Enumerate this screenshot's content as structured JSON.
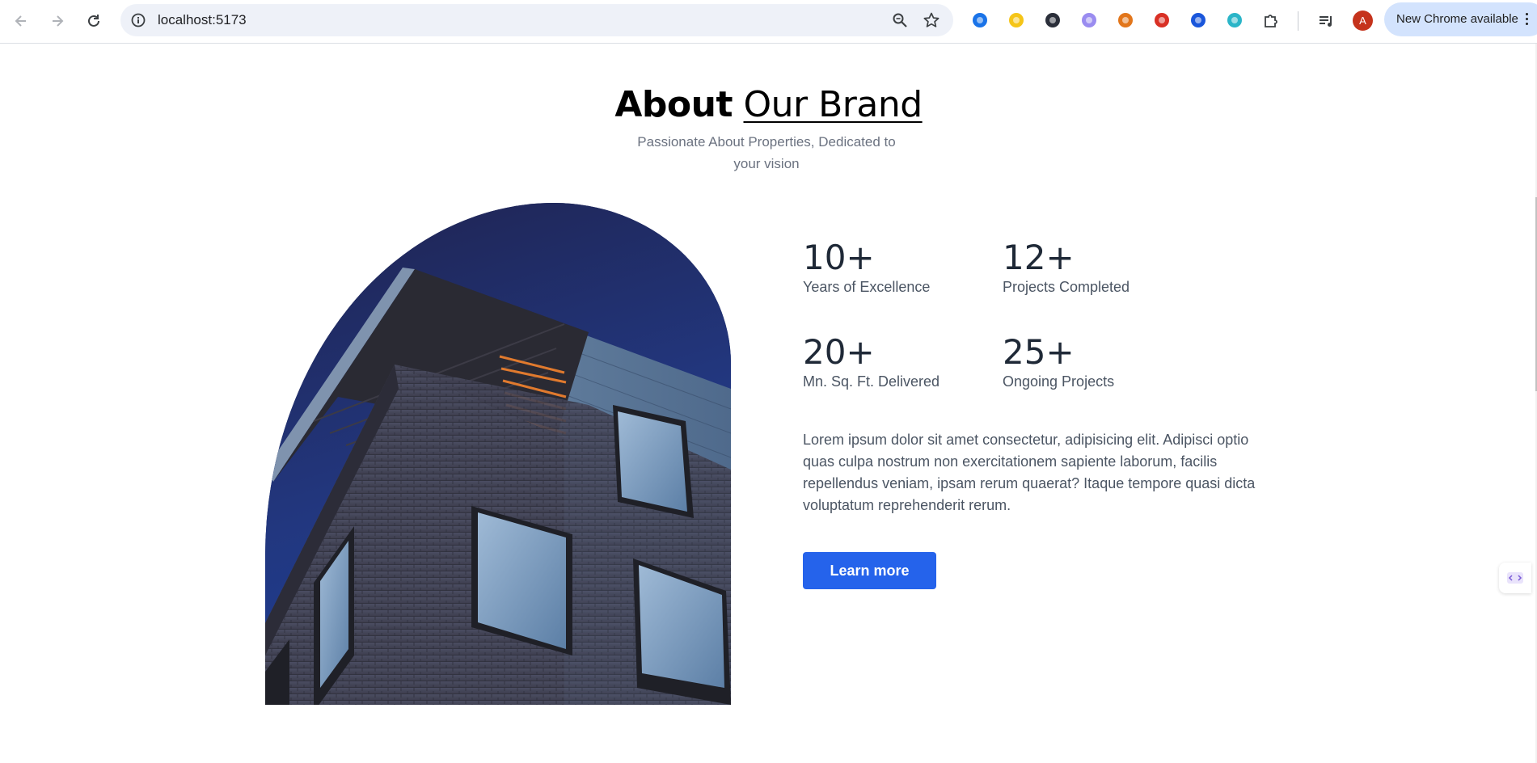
{
  "browser": {
    "url": "localhost:5173",
    "update_label": "New Chrome available",
    "avatar_letter": "A",
    "extensions": [
      {
        "name": "iobit-icon",
        "color": "#1a73e8"
      },
      {
        "name": "chick-icon",
        "color": "#f5c518"
      },
      {
        "name": "dark-app-icon",
        "color": "#2b2f3a"
      },
      {
        "name": "purple-ghost-icon",
        "color": "#9a8cf0"
      },
      {
        "name": "metamask-fox-icon",
        "color": "#e2761b"
      },
      {
        "name": "red-bug-icon",
        "color": "#d93025"
      },
      {
        "name": "blue-circle-icon",
        "color": "#1a56db"
      },
      {
        "name": "react-atom-icon",
        "color": "#2bb5c8"
      },
      {
        "name": "puzzle-icon",
        "color": "#3c4043"
      }
    ]
  },
  "about": {
    "heading_bold": "About",
    "heading_light": "Our Brand",
    "subtitle": "Passionate About Properties, Dedicated to your vision",
    "stats": [
      {
        "value": "10+",
        "label": "Years of Excellence"
      },
      {
        "value": "12+",
        "label": "Projects Completed"
      },
      {
        "value": "20+",
        "label": "Mn. Sq. Ft. Delivered"
      },
      {
        "value": "25+",
        "label": "Ongoing Projects"
      }
    ],
    "description": "Lorem ipsum dolor sit amet consectetur, adipisicing elit. Adipisci optio quas culpa nostrum non exercitationem sapiente laborum, facilis repellendus veniam, ipsam rerum quaerat? Itaque tempore quasi dicta voluptatum reprehenderit rerum.",
    "cta_label": "Learn more"
  },
  "colors": {
    "accent": "#2563eb",
    "heading": "#000000",
    "muted": "#6b7280"
  }
}
